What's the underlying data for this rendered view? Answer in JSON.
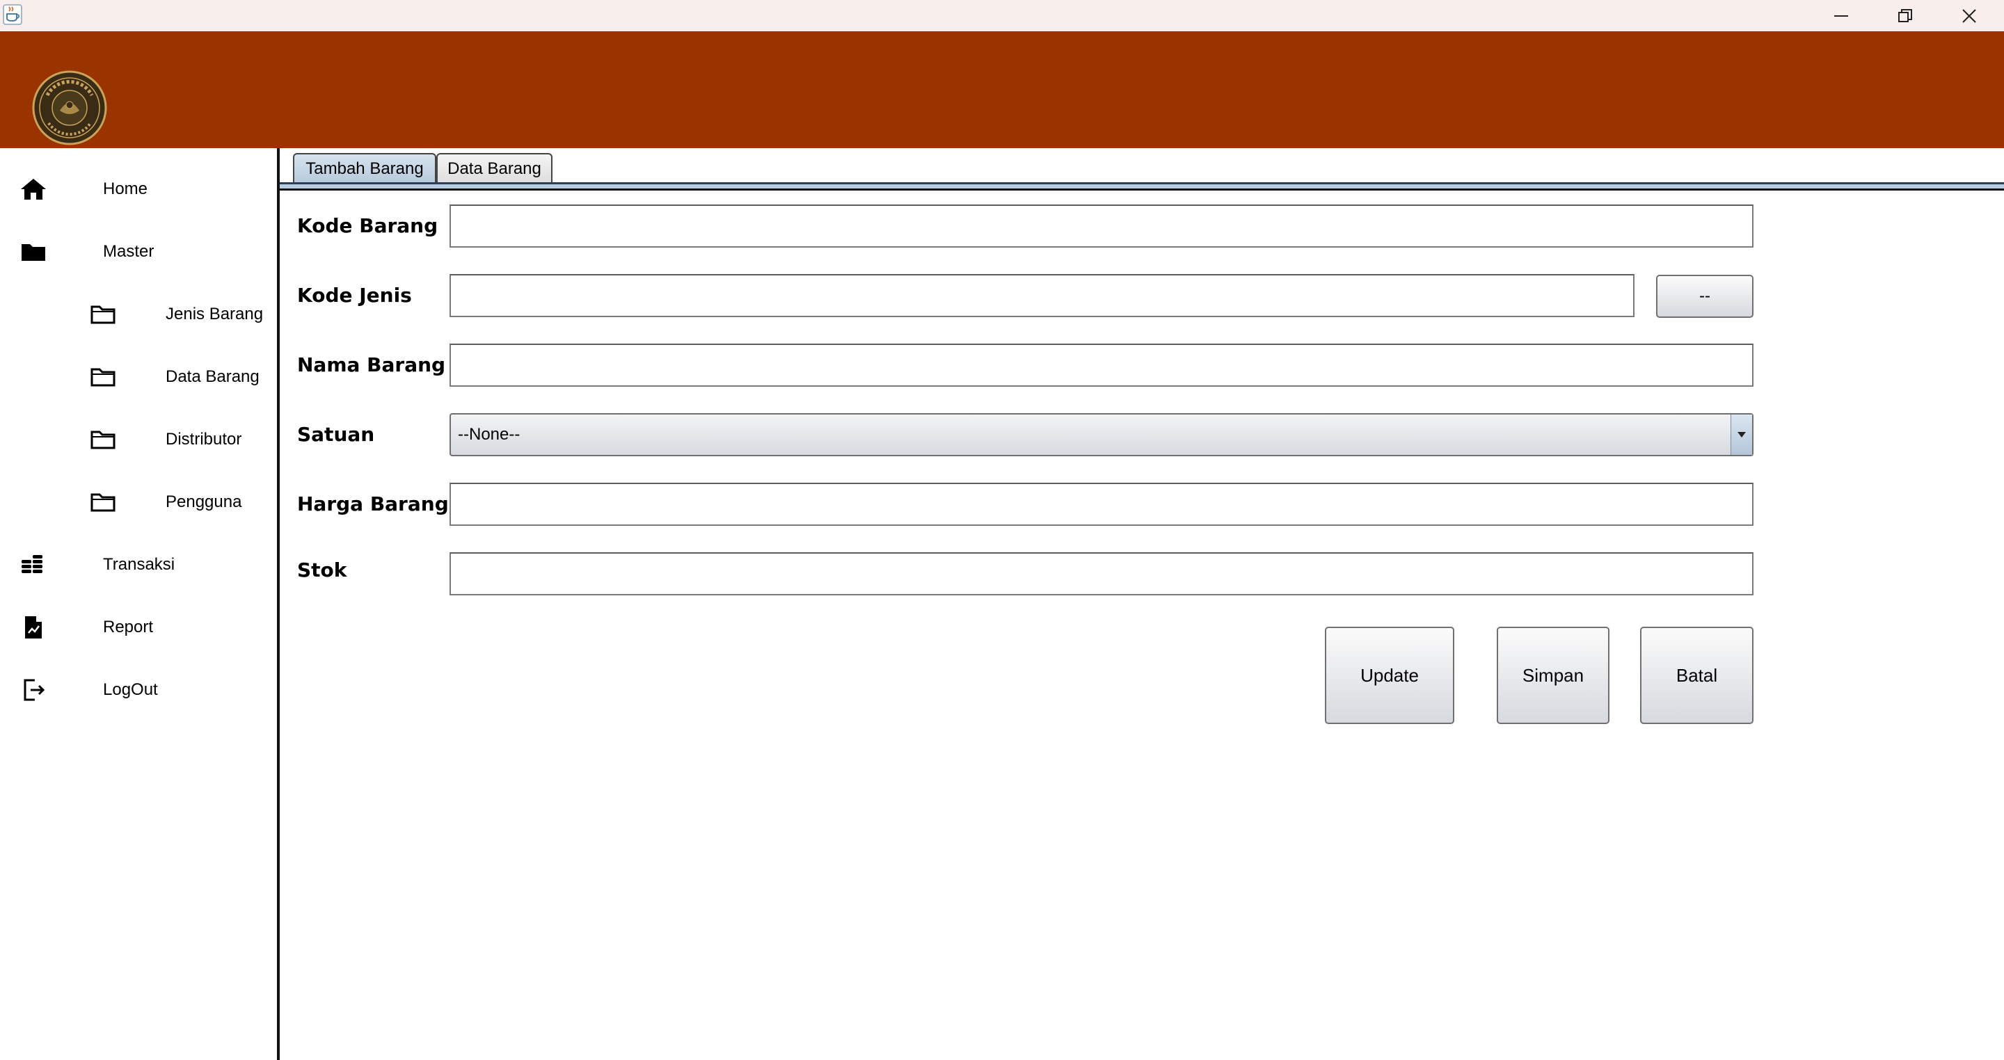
{
  "window": {
    "app_icon": "java-cup-icon",
    "controls": [
      "minimize-icon",
      "restore-icon",
      "close-icon"
    ]
  },
  "header": {
    "background": "#993300",
    "logo": "company-seal-logo"
  },
  "sidebar": {
    "items": [
      {
        "label": "Home",
        "icon": "home-icon"
      },
      {
        "label": "Master",
        "icon": "folder-filled-icon"
      },
      {
        "label": "Jenis Barang",
        "icon": "folder-outline-icon"
      },
      {
        "label": "Data Barang",
        "icon": "folder-outline-icon"
      },
      {
        "label": "Distributor",
        "icon": "folder-outline-icon"
      },
      {
        "label": "Pengguna",
        "icon": "folder-outline-icon"
      },
      {
        "label": "Transaksi",
        "icon": "coins-icon"
      },
      {
        "label": "Report",
        "icon": "report-icon"
      },
      {
        "label": "LogOut",
        "icon": "logout-icon"
      }
    ]
  },
  "tabs": [
    {
      "label": "Tambah Barang",
      "active": true
    },
    {
      "label": "Data Barang",
      "active": false
    }
  ],
  "form": {
    "kode_barang": {
      "label": "Kode Barang",
      "value": ""
    },
    "kode_jenis": {
      "label": "Kode Jenis",
      "value": "",
      "lookup_button": "--"
    },
    "nama_barang": {
      "label": "Nama Barang",
      "value": ""
    },
    "satuan": {
      "label": "Satuan",
      "selected": "--None--"
    },
    "harga_barang": {
      "label": "Harga Barang",
      "value": ""
    },
    "stok": {
      "label": "Stok",
      "value": ""
    }
  },
  "actions": {
    "update": "Update",
    "simpan": "Simpan",
    "batal": "Batal"
  }
}
